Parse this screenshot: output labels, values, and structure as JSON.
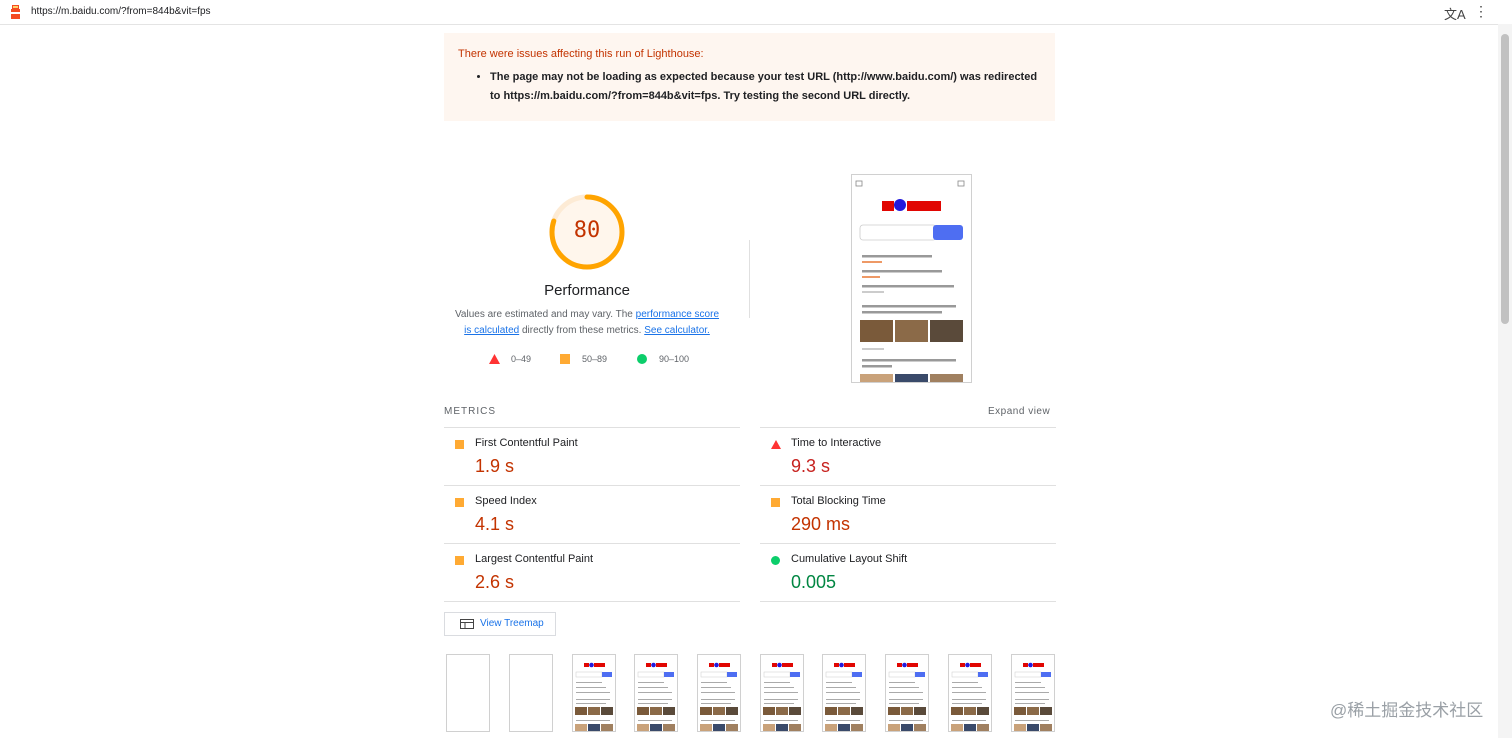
{
  "browser": {
    "url": "https://m.baidu.com/?from=844b&vit=fps",
    "translate_icon": "translate-icon",
    "menu_icon": "more-vert-icon"
  },
  "warning": {
    "title": "There were issues affecting this run of Lighthouse:",
    "items": [
      "The page may not be loading as expected because your test URL (http://www.baidu.com/) was redirected to https://m.baidu.com/?from=844b&vit=fps. Try testing the second URL directly."
    ]
  },
  "performance": {
    "score": "80",
    "score_fraction": 0.8,
    "title": "Performance",
    "desc_prefix": "Values are estimated and may vary. The ",
    "desc_link1": "performance score is calculated",
    "desc_middle": " directly from these metrics. ",
    "desc_link2": "See calculator.",
    "legend": [
      {
        "shape": "triangle",
        "color": "#ff3333",
        "label": "0–49"
      },
      {
        "shape": "square",
        "color": "#ffaa33",
        "label": "50–89"
      },
      {
        "shape": "circle",
        "color": "#0cce6b",
        "label": "90–100"
      }
    ]
  },
  "metrics": {
    "header": "METRICS",
    "expand": "Expand view",
    "items": [
      {
        "name": "First Contentful Paint",
        "value": "1.9 s",
        "status": "average"
      },
      {
        "name": "Time to Interactive",
        "value": "9.3 s",
        "status": "fail"
      },
      {
        "name": "Speed Index",
        "value": "4.1 s",
        "status": "average"
      },
      {
        "name": "Total Blocking Time",
        "value": "290 ms",
        "status": "average"
      },
      {
        "name": "Largest Contentful Paint",
        "value": "2.6 s",
        "status": "average"
      },
      {
        "name": "Cumulative Layout Shift",
        "value": "0.005",
        "status": "pass"
      }
    ]
  },
  "colors": {
    "fail": "#c7221f",
    "average": "#c33300",
    "pass": "#018642",
    "fail_icon": "#ff3333",
    "average_icon": "#ffaa33",
    "pass_icon": "#0cce6b"
  },
  "treemap": {
    "label": "View Treemap",
    "icon": "treemap-icon"
  },
  "watermark": "@稀土掘金技术社区"
}
